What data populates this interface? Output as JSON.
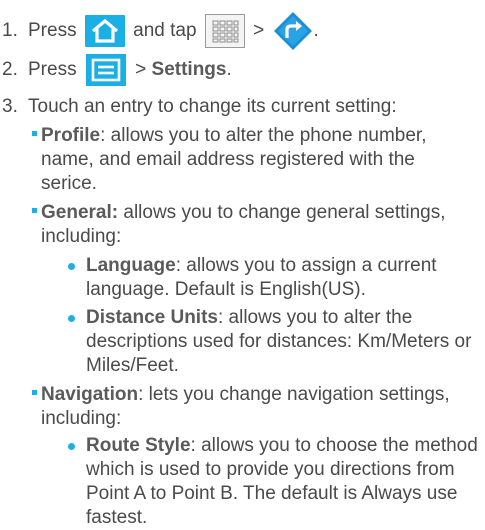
{
  "steps": [
    {
      "num": "1.",
      "pre": "Press",
      "mid": "and tap",
      "sep": ">"
    },
    {
      "num": "2.",
      "pre": "Press",
      "sep_text": " > ",
      "bold": "Settings",
      "end": "."
    },
    {
      "num": "3.",
      "text": "Touch an entry to change its current setting:"
    }
  ],
  "step1_end": ".",
  "sections": {
    "profile": {
      "title": "Profile",
      "desc": ": allows you to alter the phone number,",
      "line2": "name, and email address registered with the",
      "line3": "serice."
    },
    "general": {
      "title": "General:",
      "desc": " allows you to change general settings,",
      "line2": "including:",
      "items": {
        "language": {
          "title": "Language",
          "l1": ": allows you to assign a current",
          "l2": "language. Default is English(US)."
        },
        "distance": {
          "title": "Distance Units",
          "l1": ": allows you to alter the",
          "l2": "descriptions used for distances: Km/Meters or",
          "l3": "Miles/Feet."
        }
      }
    },
    "navigation": {
      "title": "Navigation",
      "desc": ": lets you change navigation settings,",
      "line2": "including:",
      "items": {
        "route": {
          "title": "Route Style",
          "l1": ": allows you to choose the method",
          "l2": "which is used to provide you directions from",
          "l3": "Point A to Point B. The default is Always use",
          "l4": "fastest."
        }
      }
    }
  },
  "icons": {
    "home": "home-key-icon",
    "apps": "applications-grid-icon",
    "nav": "navigation-app-icon",
    "menu": "menu-key-icon"
  },
  "colors": {
    "accent": "#1ab0e6",
    "text": "#4a4a4a"
  }
}
